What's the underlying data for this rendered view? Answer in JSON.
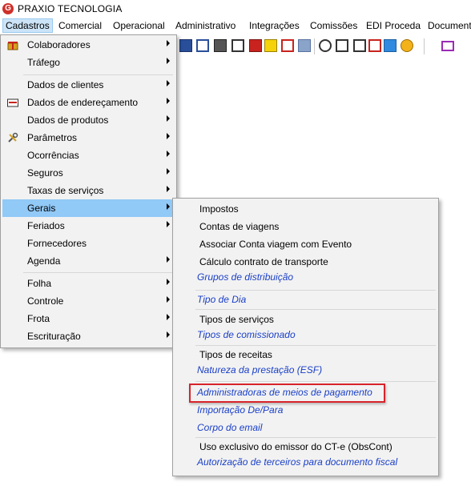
{
  "app": {
    "title": "PRAXIO TECNOLOGIA",
    "logo_text": "G"
  },
  "menubar": {
    "items": [
      "Cadastros",
      "Comercial",
      "Operacional",
      "Administrativo",
      "Integrações",
      "Comissões",
      "EDI Proceda",
      "Document"
    ]
  },
  "cadastros_menu": {
    "items": [
      {
        "label": "Colaboradores",
        "icon": "gift-icon",
        "submenu": true
      },
      {
        "label": "Tráfego",
        "submenu": true
      },
      {
        "label": "Dados de clientes",
        "submenu": true
      },
      {
        "label": "Dados de endereçamento",
        "icon": "envelope-icon",
        "submenu": true
      },
      {
        "label": "Dados de produtos",
        "submenu": true
      },
      {
        "label": "Parâmetros",
        "icon": "tools-icon",
        "submenu": true
      },
      {
        "label": "Ocorrências",
        "submenu": true
      },
      {
        "label": "Seguros",
        "submenu": true
      },
      {
        "label": "Taxas de serviços",
        "submenu": true
      },
      {
        "label": "Gerais",
        "submenu": true,
        "highlighted": true
      },
      {
        "label": "Feriados",
        "submenu": true
      },
      {
        "label": "Fornecedores",
        "submenu": false
      },
      {
        "label": "Agenda",
        "submenu": true
      },
      {
        "label": "Folha",
        "submenu": true
      },
      {
        "label": "Controle",
        "submenu": true
      },
      {
        "label": "Frota",
        "submenu": true
      },
      {
        "label": "Escrituração",
        "submenu": true
      }
    ]
  },
  "gerais_menu": {
    "items": [
      {
        "label": "Impostos",
        "link": false
      },
      {
        "label": "Contas de viagens",
        "link": false
      },
      {
        "label": "Associar Conta viagem com Evento",
        "link": false
      },
      {
        "label": "Cálculo contrato de transporte",
        "link": false
      },
      {
        "label": "Grupos de distribuição",
        "link": true
      },
      {
        "label": "Tipo de Dia",
        "link": true
      },
      {
        "label": "Tipos de serviços",
        "link": false
      },
      {
        "label": "Tipos de comissionado",
        "link": true
      },
      {
        "label": "Tipos de receitas",
        "link": false
      },
      {
        "label": "Natureza da prestação (ESF)",
        "link": true
      },
      {
        "label": "Administradoras de meios de pagamento",
        "link": true,
        "annotated": true
      },
      {
        "label": "Importação De/Para",
        "link": true
      },
      {
        "label": "Corpo do email",
        "link": true
      },
      {
        "label": "Uso exclusivo do emissor do CT-e (ObsCont)",
        "link": false
      },
      {
        "label": "Autorização de terceiros para documento fiscal",
        "link": true
      }
    ]
  },
  "colors": {
    "link": "#1a3fc7",
    "highlight": "#91c9f7",
    "annotation": "#d8232a",
    "menu_bg": "#f2f2f2"
  }
}
